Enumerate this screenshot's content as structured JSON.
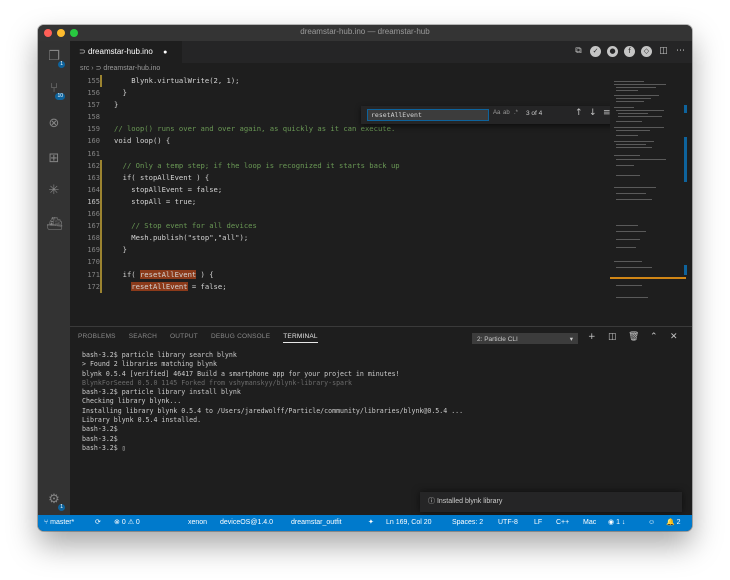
{
  "window": {
    "title": "dreamstar-hub.ino — dreamstar-hub"
  },
  "colors": {
    "close": "#ff5f57",
    "minimize": "#febc2e",
    "zoom": "#28c840",
    "accent": "#007acc",
    "highlight": "#8b3a1a"
  },
  "activity_bar": {
    "items": [
      {
        "name": "explorer-icon",
        "badge": "1"
      },
      {
        "name": "source-control-icon",
        "badge": "10"
      },
      {
        "name": "debug-icon"
      },
      {
        "name": "extensions-icon"
      },
      {
        "name": "particle-icon"
      },
      {
        "name": "docker-icon"
      }
    ],
    "manage_badge": "1"
  },
  "tab": {
    "label": "dreamstar-hub.ino",
    "icon": "file-icon",
    "modified": "●"
  },
  "breadcrumb": {
    "folder": "src",
    "separator": "›",
    "file": "dreamstar-hub.ino"
  },
  "editor": {
    "line_numbers": [
      "155",
      "156",
      "157",
      "158",
      "159",
      "160",
      "161",
      "162",
      "163",
      "164",
      "165",
      "166",
      "167",
      "168",
      "169",
      "170",
      "171",
      "172"
    ],
    "lines": [
      "    Blynk.virtualWrite(2, 1);",
      "  }",
      "}",
      "",
      "// loop() runs over and over again, as quickly as it can execute.",
      "void loop() {",
      "",
      "  // Only a temp step; if the loop is recognized it starts back up",
      "  if( stopAllEvent ) {",
      "    stopAllEvent = false;",
      "    stopAll = true;",
      "",
      "    // Stop event for all devices",
      "    Mesh.publish(\"stop\",\"all\");",
      "  }",
      "",
      "  if( resetAllEvent ) {",
      "    resetAllEvent = false;"
    ]
  },
  "find_widget": {
    "value": "resetAllEvent",
    "match_case": "Aa",
    "whole_word": "ab",
    "regex": ".*",
    "count": "3 of 4"
  },
  "panel": {
    "tabs": [
      "PROBLEMS",
      "SEARCH",
      "OUTPUT",
      "DEBUG CONSOLE",
      "TERMINAL"
    ],
    "active_tab": "TERMINAL",
    "terminal_select": "2: Particle CLI",
    "terminal_lines": [
      "bash-3.2$ particle library search blynk",
      "> Found 2 libraries matching blynk",
      "blynk 0.5.4 [verified] 46417 Build a smartphone app for your project in minutes!",
      "BlynkForSeeed 0.5.0 1145 Forked from vshymanskyy/blynk-library-spark",
      "bash-3.2$ particle library install blynk",
      "Checking library blynk...",
      "Installing library blynk 0.5.4 to /Users/jaredwolff/Particle/community/libraries/blynk@0.5.4 ...",
      "Library blynk 0.5.4 installed.",
      "bash-3.2$",
      "bash-3.2$",
      "bash-3.2$ ▯"
    ],
    "notification": "Installed blynk library"
  },
  "status_bar": {
    "branch": "master*",
    "sync": "⟳",
    "errors": "0",
    "warnings": "0",
    "device": "xenon",
    "os": "deviceOS@1.4.0",
    "target": "dreamstar_outfit",
    "position": "Ln 169, Col 20",
    "spaces": "Spaces: 2",
    "encoding": "UTF-8",
    "eol": "LF",
    "language": "C++",
    "platform": "Mac",
    "live_share": "1 ↓"
  }
}
